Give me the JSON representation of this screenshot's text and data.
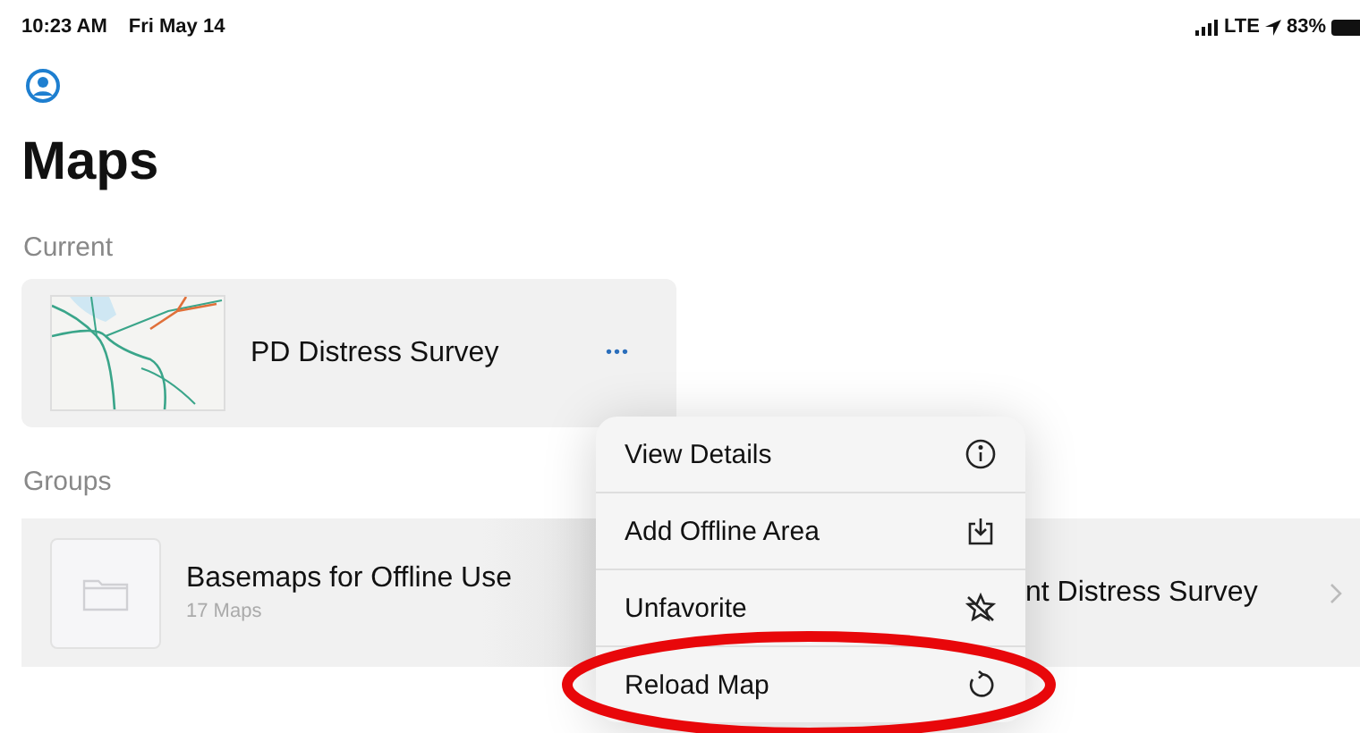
{
  "status_bar": {
    "time": "10:23 AM",
    "date": "Fri May 14",
    "network": "LTE",
    "battery": "83%"
  },
  "title": "Maps",
  "current": {
    "heading": "Current",
    "maps": [
      {
        "name": "PD Distress Survey",
        "more": "•••"
      }
    ]
  },
  "groups": {
    "heading": "Groups",
    "items": [
      {
        "name": "Basemaps for Offline Use",
        "count": "17 Maps"
      },
      {
        "name": "nt Distress Survey"
      }
    ]
  },
  "menu": {
    "items": [
      {
        "label": "View Details",
        "highlighted": false
      },
      {
        "label": "Add Offline Area",
        "highlighted": false
      },
      {
        "label": "Unfavorite",
        "highlighted": false
      },
      {
        "label": "Reload Map",
        "highlighted": true
      }
    ]
  }
}
